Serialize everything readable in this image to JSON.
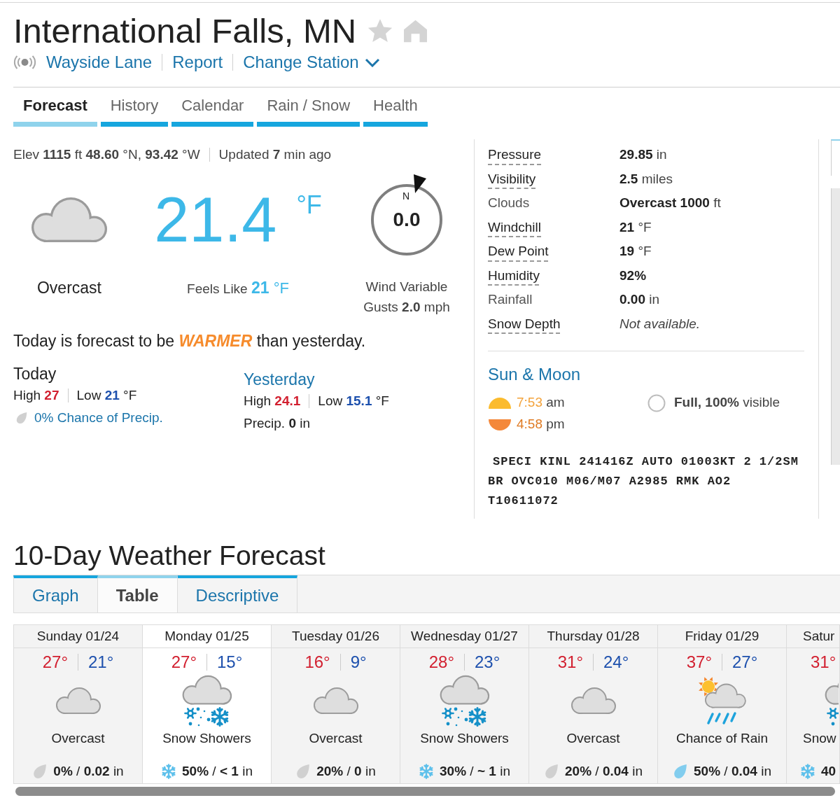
{
  "header": {
    "title": "International Falls, MN",
    "links": [
      {
        "label": "Wayside Lane",
        "kind": "station"
      },
      {
        "label": "Report",
        "kind": "report"
      },
      {
        "label": "Change Station",
        "kind": "menu"
      }
    ]
  },
  "tabs": [
    {
      "label": "Forecast",
      "selected": true
    },
    {
      "label": "History",
      "selected": false
    },
    {
      "label": "Calendar",
      "selected": false
    },
    {
      "label": "Rain / Snow",
      "selected": false
    },
    {
      "label": "Health",
      "selected": false
    }
  ],
  "current": {
    "station_meta": "Elev **1115** ft **48.60** °N, **93.42** °W",
    "updated": "Updated **7** min ago",
    "kind": "overcast",
    "condition": "Overcast",
    "temperature": "21.4",
    "unit": "°F",
    "feels_like": {
      "label": "Feels Like",
      "value": "21",
      "unit": "°F"
    }
  },
  "wind": {
    "north": "N",
    "speed": "0.0",
    "description": "Wind Variable",
    "gusts": "Gusts **2.0** mph"
  },
  "outlook": {
    "before": "Today is forecast to be",
    "emphasis": "WARMER",
    "after": "than yesterday."
  },
  "today": {
    "title": "Today",
    "high_label": "High",
    "high": "27",
    "low_label": "Low",
    "low": "21",
    "unit": "°F",
    "precip": {
      "kind": "dry",
      "text": "0% Chance of Precip."
    }
  },
  "yesterday": {
    "title": "Yesterday",
    "high_label": "High",
    "high": "24.1",
    "low_label": "Low",
    "low": "15.1",
    "unit": "°F",
    "precip": "Precip. **0** in"
  },
  "conditions": [
    {
      "label": "Pressure",
      "has_tooltip": true,
      "kind": "reading",
      "value": "29.85",
      "unit": "in"
    },
    {
      "label": "Visibility",
      "has_tooltip": true,
      "kind": "reading",
      "value": "2.5",
      "unit": "miles"
    },
    {
      "label": "Clouds",
      "has_tooltip": false,
      "kind": "reading",
      "value": "Overcast 1000",
      "unit": "ft"
    },
    {
      "label": "Windchill",
      "has_tooltip": true,
      "kind": "reading",
      "value": "21",
      "unit": "°F"
    },
    {
      "label": "Dew Point",
      "has_tooltip": true,
      "kind": "reading",
      "value": "19",
      "unit": "°F"
    },
    {
      "label": "Humidity",
      "has_tooltip": true,
      "kind": "reading",
      "value": "92%"
    },
    {
      "label": "Rainfall",
      "has_tooltip": false,
      "kind": "reading",
      "value": "0.00",
      "unit": "in"
    },
    {
      "label": "Snow Depth",
      "has_tooltip": true,
      "kind": "unavailable",
      "value": "Not available."
    }
  ],
  "sun_moon": {
    "title": "Sun & Moon",
    "sunrise": {
      "time": "7:53",
      "suffix": "am"
    },
    "sunset": {
      "time": "4:58",
      "suffix": "pm"
    },
    "moon": "**Full, 100%** visible"
  },
  "metar": "SPECI KINL 241416Z AUTO 01003KT 2 1/2SM BR OVC010 M06/M07 A2985 RMK AO2 T10611072",
  "ten_day": {
    "title": "10-Day Weather Forecast",
    "tabs": [
      {
        "label": "Graph",
        "selected": false
      },
      {
        "label": "Table",
        "selected": true
      },
      {
        "label": "Descriptive",
        "selected": false
      }
    ],
    "days": [
      {
        "date": "Sunday 01/24",
        "high": "27°",
        "low": "21°",
        "kind": "overcast",
        "condition": "Overcast",
        "precip": {
          "kind": "dry",
          "text": "**0%** / **0.02** in"
        },
        "selected": false,
        "cut_off": false
      },
      {
        "date": "Monday 01/25",
        "high": "27°",
        "low": "15°",
        "kind": "snow_showers",
        "condition": "Snow Showers",
        "precip": {
          "kind": "snow",
          "text": "**50%** / **< 1** in"
        },
        "selected": true,
        "cut_off": false
      },
      {
        "date": "Tuesday 01/26",
        "high": "16°",
        "low": "9°",
        "kind": "overcast",
        "condition": "Overcast",
        "precip": {
          "kind": "dry",
          "text": "**20%** / **0** in"
        },
        "selected": false,
        "cut_off": false
      },
      {
        "date": "Wednesday 01/27",
        "high": "28°",
        "low": "23°",
        "kind": "snow_showers",
        "condition": "Snow Showers",
        "precip": {
          "kind": "snow",
          "text": "**30%** / **~ 1** in"
        },
        "selected": false,
        "cut_off": false
      },
      {
        "date": "Thursday 01/28",
        "high": "31°",
        "low": "24°",
        "kind": "overcast",
        "condition": "Overcast",
        "precip": {
          "kind": "dry",
          "text": "**20%** / **0.04** in"
        },
        "selected": false,
        "cut_off": false
      },
      {
        "date": "Friday 01/29",
        "high": "37°",
        "low": "27°",
        "kind": "chance_rain",
        "condition": "Chance of Rain",
        "precip": {
          "kind": "rain",
          "text": "**50%** / **0.04** in"
        },
        "selected": false,
        "cut_off": false
      },
      {
        "date": "Satur",
        "high": "31°",
        "kind": "snow_showers",
        "condition": "Snow",
        "precip": {
          "kind": "snow",
          "text": "**40**"
        },
        "selected": false,
        "cut_off": true
      }
    ]
  }
}
